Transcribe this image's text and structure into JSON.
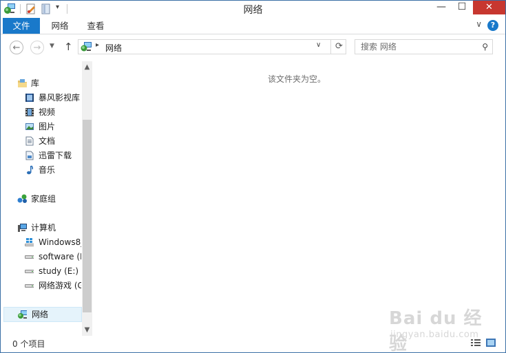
{
  "window": {
    "title": "网络"
  },
  "ribbon": {
    "tabs": [
      {
        "label": "文件"
      },
      {
        "label": "网络"
      },
      {
        "label": "查看"
      }
    ]
  },
  "address": {
    "path_label": "网络"
  },
  "search": {
    "placeholder": "搜索 网络"
  },
  "nav": {
    "items": [
      {
        "label": "库",
        "icon": "library-icon"
      },
      {
        "label": "暴风影视库",
        "icon": "video-library-icon"
      },
      {
        "label": "视频",
        "icon": "film-icon"
      },
      {
        "label": "图片",
        "icon": "picture-icon"
      },
      {
        "label": "文档",
        "icon": "document-icon"
      },
      {
        "label": "迅雷下载",
        "icon": "download-folder-icon"
      },
      {
        "label": "音乐",
        "icon": "music-icon"
      },
      {
        "label": "家庭组",
        "icon": "homegroup-icon"
      },
      {
        "label": "计算机",
        "icon": "computer-icon"
      },
      {
        "label": "Windows8_",
        "icon": "windows-drive-icon"
      },
      {
        "label": "software (D",
        "icon": "drive-icon"
      },
      {
        "label": "study (E:)",
        "icon": "drive-icon"
      },
      {
        "label": "网络游戏 (G",
        "icon": "drive-icon"
      },
      {
        "label": "网络",
        "icon": "network-icon"
      }
    ]
  },
  "content": {
    "empty_message": "该文件夹为空。"
  },
  "status": {
    "item_count": "0 个项目"
  },
  "watermark": {
    "main": "Bai du 经验",
    "sub": "jingyan.baidu.com"
  },
  "colors": {
    "accent": "#1979ca",
    "close": "#c7372f",
    "selection": "#e5f3fb"
  }
}
